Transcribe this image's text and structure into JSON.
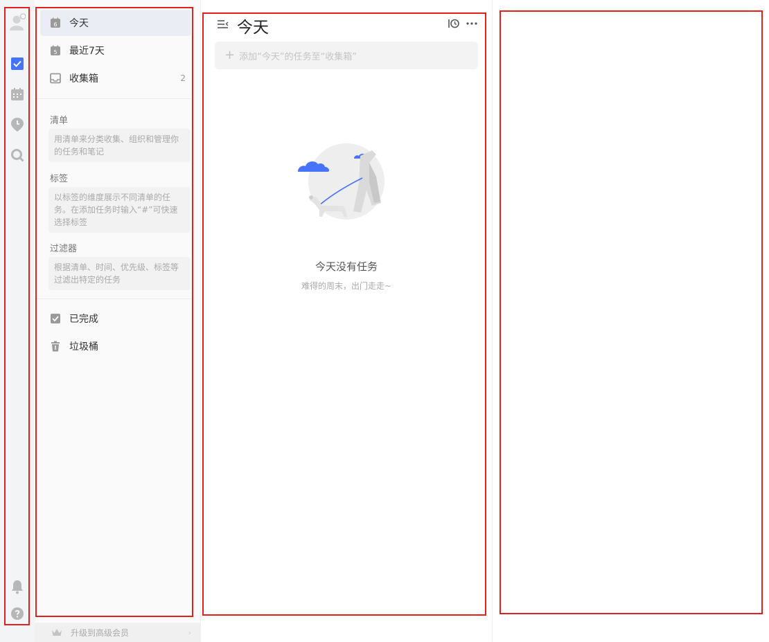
{
  "rail": {
    "icons": [
      "avatar",
      "checkbox-icon",
      "calendar-icon",
      "pomodoro-icon",
      "search-icon",
      "bell-icon",
      "help-icon"
    ]
  },
  "sidebar": {
    "nav": [
      {
        "label": "今天",
        "icon": "calendar-today-icon",
        "date": "6",
        "count": ""
      },
      {
        "label": "最近7天",
        "icon": "calendar-week-icon",
        "date": "5",
        "count": ""
      },
      {
        "label": "收集箱",
        "icon": "inbox-icon",
        "count": "2"
      }
    ],
    "sections": [
      {
        "title": "清单",
        "hint": "用清单来分类收集、组织和管理你的任务和笔记"
      },
      {
        "title": "标签",
        "hint": "以标签的维度展示不同清单的任务。在添加任务时输入“#”可快速选择标签"
      },
      {
        "title": "过滤器",
        "hint": "根据清单、时间、优先级、标签等过滤出特定的任务"
      }
    ],
    "bottom": [
      {
        "label": "已完成",
        "icon": "completed-icon"
      },
      {
        "label": "垃圾桶",
        "icon": "trash-icon"
      }
    ],
    "upgrade_label": "升级到高级会员"
  },
  "main": {
    "title": "今天",
    "add_placeholder": "添加“今天”的任务至“收集箱”",
    "empty_title": "今天没有任务",
    "empty_subtitle": "难得的周末，出门走走~"
  },
  "colors": {
    "accent": "#4772fa",
    "highlight_border": "#e3201e",
    "rail_bg": "#f3f4f6"
  }
}
